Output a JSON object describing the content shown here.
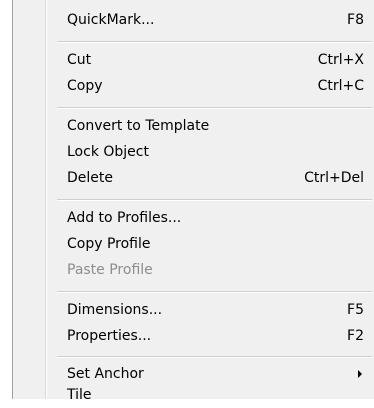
{
  "menu": {
    "items": [
      {
        "label": "QuickMark...",
        "shortcut": "F8"
      },
      {
        "label": "Cut",
        "shortcut": "Ctrl+X"
      },
      {
        "label": "Copy",
        "shortcut": "Ctrl+C"
      },
      {
        "label": "Convert to Template",
        "shortcut": ""
      },
      {
        "label": "Lock Object",
        "shortcut": ""
      },
      {
        "label": "Delete",
        "shortcut": "Ctrl+Del"
      },
      {
        "label": "Add to Profiles...",
        "shortcut": ""
      },
      {
        "label": "Copy Profile",
        "shortcut": ""
      },
      {
        "label": "Paste Profile",
        "shortcut": "",
        "disabled": true
      },
      {
        "label": "Dimensions...",
        "shortcut": "F5"
      },
      {
        "label": "Properties...",
        "shortcut": "F2"
      },
      {
        "label": "Set Anchor",
        "shortcut": "",
        "submenu": true
      },
      {
        "label": "Tile",
        "shortcut": ""
      }
    ],
    "submenu_icon": "chevron-right-icon",
    "colors": {
      "background": "#f0f0f0",
      "text": "#000000",
      "disabled_text": "#8d8d8d",
      "separator": "#cfcfcf"
    }
  }
}
